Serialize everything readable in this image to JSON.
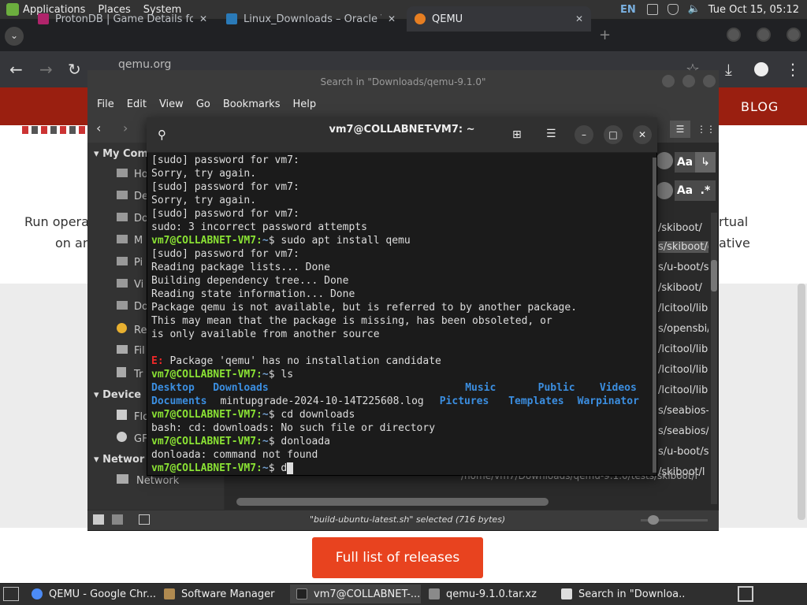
{
  "top_panel": {
    "menus": [
      "Applications",
      "Places",
      "System"
    ],
    "lang": "EN",
    "clock": "Tue Oct 15, 05:12"
  },
  "browser": {
    "tabs": [
      {
        "title": "ProtonDB | Game Details for",
        "active": false
      },
      {
        "title": "Linux_Downloads – Oracle V",
        "active": false
      },
      {
        "title": "QEMU",
        "active": true
      }
    ],
    "url": "qemu.org",
    "nav_blog": "BLOG",
    "page_text_left": [
      "Run opera",
      "on an"
    ],
    "page_text_right": [
      "rtual",
      "ative"
    ],
    "releases_button": "Full list of releases"
  },
  "file_manager": {
    "title": "Search in \"Downloads/qemu-9.1.0\"",
    "menu": [
      "File",
      "Edit",
      "View",
      "Go",
      "Bookmarks",
      "Help"
    ],
    "sidebar": {
      "my_computer_header": "My Com",
      "items": [
        "Ho",
        "De",
        "Do",
        "M",
        "Pi",
        "Vi",
        "Do",
        "Re",
        "Fil",
        "Tr"
      ],
      "devices_header": "Device",
      "devices": [
        "Flo",
        "GF"
      ],
      "network_header": "Networ",
      "network": [
        "Network"
      ]
    },
    "paths": [
      "/skiboot/",
      "s/skiboot/c",
      "s/u-boot/s",
      "/skiboot/",
      "/lcitool/lib",
      "s/opensbi/",
      "/lcitool/lib",
      "/lcitool/lib",
      "/lcitool/lib",
      "s/seabios-h",
      "s/seabios/s",
      "s/u-boot/s",
      "/skiboot/l"
    ],
    "bottom_row": "/home/vm7/Downloads/qemu-9.1.0/tests/skiboot/l",
    "status": "\"build-ubuntu-latest.sh\" selected (716 bytes)",
    "search_opts": [
      "Aa",
      "Aa",
      ".*"
    ]
  },
  "terminal": {
    "title": "vm7@COLLABNET-VM7: ~",
    "lines": [
      {
        "t": "[sudo] password for vm7:"
      },
      {
        "t": "Sorry, try again."
      },
      {
        "t": "[sudo] password for vm7:"
      },
      {
        "t": "Sorry, try again."
      },
      {
        "t": "[sudo] password for vm7:"
      },
      {
        "t": "sudo: 3 incorrect password attempts"
      },
      {
        "prompt": "vm7@COLLABNET-VM7",
        "path": "~",
        "cmd": "sudo apt install qemu"
      },
      {
        "t": "[sudo] password for vm7:"
      },
      {
        "t": "Reading package lists... Done"
      },
      {
        "t": "Building dependency tree... Done"
      },
      {
        "t": "Reading state information... Done"
      },
      {
        "t": "Package qemu is not available, but is referred to by another package."
      },
      {
        "t": "This may mean that the package is missing, has been obsoleted, or"
      },
      {
        "t": "is only available from another source"
      },
      {
        "t": ""
      },
      {
        "err": "E:",
        "t": " Package 'qemu' has no installation candidate"
      },
      {
        "prompt": "vm7@COLLABNET-VM7",
        "path": "~",
        "cmd": "ls"
      },
      {
        "ls": [
          [
            "Desktop",
            "dir"
          ],
          [
            "Downloads",
            "dir"
          ],
          [
            "",
            ""
          ],
          [
            "Music",
            "dir"
          ],
          [
            "Public",
            "dir"
          ],
          [
            "Videos",
            "dir"
          ]
        ]
      },
      {
        "ls": [
          [
            "Documents",
            "dir"
          ],
          [
            "mintupgrade-2024-10-14T225608.log",
            ""
          ],
          [
            "Pictures",
            "dir"
          ],
          [
            "Templates",
            "dir"
          ],
          [
            "Warpinator",
            "dir"
          ]
        ]
      },
      {
        "prompt": "vm7@COLLABNET-VM7",
        "path": "~",
        "cmd": "cd downloads"
      },
      {
        "t": "bash: cd: downloads: No such file or directory"
      },
      {
        "prompt": "vm7@COLLABNET-VM7",
        "path": "~",
        "cmd": "donloada"
      },
      {
        "t": "donloada: command not found"
      },
      {
        "prompt": "vm7@COLLABNET-VM7",
        "path": "~",
        "cmd": "d",
        "cursor": true
      }
    ]
  },
  "taskbar": {
    "items": [
      {
        "label": "QEMU - Google Chr...",
        "active": false
      },
      {
        "label": "Software Manager",
        "active": false
      },
      {
        "label": "vm7@COLLABNET-...",
        "active": true
      },
      {
        "label": "qemu-9.1.0.tar.xz",
        "active": false
      },
      {
        "label": "Search in \"Downloa...",
        "active": false
      }
    ]
  }
}
